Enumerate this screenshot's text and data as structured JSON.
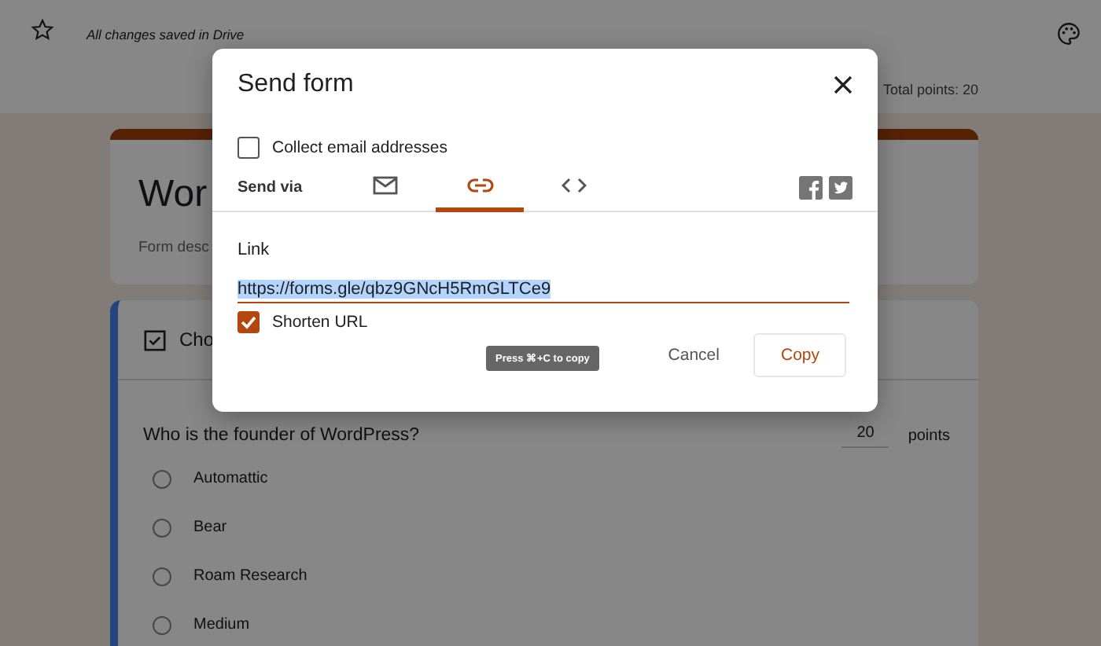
{
  "header": {
    "status": "All changes saved in Drive",
    "total_points": "Total points: 20"
  },
  "form": {
    "title": "Wor",
    "description": "Form desc"
  },
  "question": {
    "section": "Cho",
    "text": "Who is the founder of WordPress?",
    "points": "20",
    "points_label": "points",
    "options": [
      {
        "label": "Automattic",
        "selected": false
      },
      {
        "label": "Bear",
        "selected": false
      },
      {
        "label": "Roam Research",
        "selected": false
      },
      {
        "label": "Medium",
        "selected": false
      }
    ]
  },
  "dialog": {
    "title": "Send form",
    "collect_email": {
      "label": "Collect email addresses",
      "checked": false
    },
    "send_via": "Send via",
    "methods": [
      {
        "kind": "email",
        "selected": false
      },
      {
        "kind": "link",
        "selected": true
      },
      {
        "kind": "embed",
        "selected": false
      }
    ],
    "link_label": "Link",
    "url": "https://forms.gle/qbz9GNcH5RmGLTCe9",
    "shorten": {
      "label": "Shorten URL",
      "checked": true
    },
    "tooltip": "Press ⌘+C to copy",
    "buttons": [
      "Cancel",
      "Copy"
    ]
  }
}
